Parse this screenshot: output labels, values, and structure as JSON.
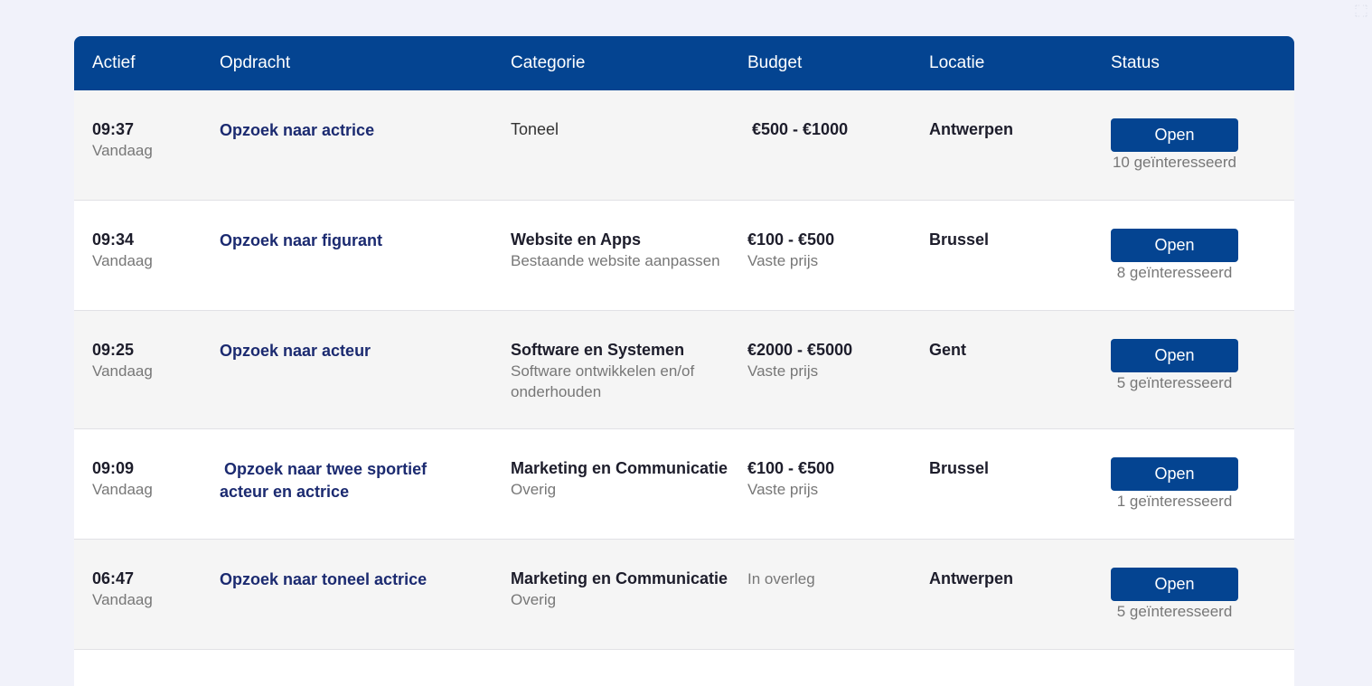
{
  "table": {
    "headers": {
      "active": "Actief",
      "task": "Opdracht",
      "category": "Categorie",
      "budget": "Budget",
      "location": "Locatie",
      "status": "Status"
    },
    "rows": [
      {
        "time": "09:37",
        "day": "Vandaag",
        "title": "Opzoek naar actrice",
        "category": "Toneel",
        "subcategory": "",
        "budget": " €500 - €1000",
        "budget_note": "",
        "location": "Antwerpen",
        "status": "Open",
        "interested": "10 geïnteresseerd"
      },
      {
        "time": "09:34",
        "day": "Vandaag",
        "title": "Opzoek naar figurant",
        "category": "Website en Apps",
        "subcategory": "Bestaande website aanpassen",
        "budget": "€100 - €500",
        "budget_note": "Vaste prijs",
        "location": "Brussel",
        "status": "Open",
        "interested": "8 geïnteresseerd"
      },
      {
        "time": "09:25",
        "day": "Vandaag",
        "title": "Opzoek naar acteur",
        "category": "Software en Systemen",
        "subcategory": "Software ontwikkelen en/of onderhouden",
        "budget": "€2000 - €5000",
        "budget_note": "Vaste prijs",
        "location": "Gent",
        "status": "Open",
        "interested": "5 geïnteresseerd"
      },
      {
        "time": "09:09",
        "day": "Vandaag",
        "title": " Opzoek naar twee sportief acteur en actrice",
        "category": "Marketing en Communicatie",
        "subcategory": "Overig",
        "budget": "€100 - €500",
        "budget_note": "Vaste prijs",
        "location": "Brussel",
        "status": "Open",
        "interested": "1 geïnteresseerd"
      },
      {
        "time": "06:47",
        "day": "Vandaag",
        "title": "Opzoek naar toneel actrice",
        "category": "Marketing en Communicatie",
        "subcategory": "Overig",
        "budget": "",
        "budget_note": "In overleg",
        "location": "Antwerpen",
        "status": "Open",
        "interested": "5 geïnteresseerd"
      }
    ]
  },
  "colors": {
    "header_bg": "#044491",
    "button_bg": "#044491",
    "title_link": "#1b2a70",
    "page_bg": "#f1f2fa"
  }
}
